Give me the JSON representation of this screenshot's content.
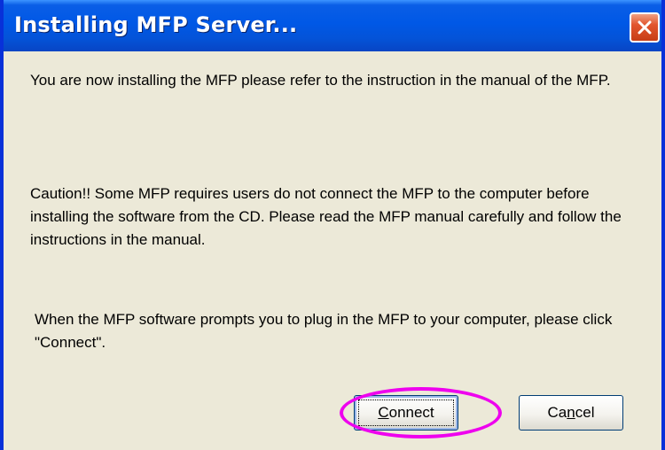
{
  "window": {
    "title": "Installing MFP Server...",
    "close_icon": "close-icon"
  },
  "messages": {
    "intro": "You are now installing the MFP please refer to the instruction in the manual of the MFP.",
    "caution": "Caution!! Some MFP requires users do not connect the MFP to the computer before installing the software from the CD. Please read the MFP manual carefully and follow the instructions in the manual.",
    "prompt": "When the MFP software prompts you to plug in the MFP to your computer, please click \"Connect\"."
  },
  "buttons": {
    "connect_mnemonic": "C",
    "connect_rest": "onnect",
    "cancel_pre": "Ca",
    "cancel_mnemonic": "n",
    "cancel_rest": "cel"
  },
  "colors": {
    "titlebar": "#0058e6",
    "dialog_bg": "#ece9d8",
    "highlight": "#ee00ee"
  }
}
